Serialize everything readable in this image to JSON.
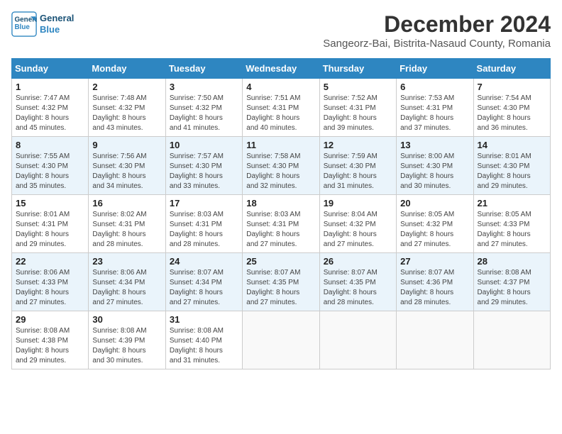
{
  "header": {
    "logo_line1": "General",
    "logo_line2": "Blue",
    "title": "December 2024",
    "subtitle": "Sangeorz-Bai, Bistrita-Nasaud County, Romania"
  },
  "weekdays": [
    "Sunday",
    "Monday",
    "Tuesday",
    "Wednesday",
    "Thursday",
    "Friday",
    "Saturday"
  ],
  "weeks": [
    [
      {
        "day": "1",
        "info": "Sunrise: 7:47 AM\nSunset: 4:32 PM\nDaylight: 8 hours\nand 45 minutes."
      },
      {
        "day": "2",
        "info": "Sunrise: 7:48 AM\nSunset: 4:32 PM\nDaylight: 8 hours\nand 43 minutes."
      },
      {
        "day": "3",
        "info": "Sunrise: 7:50 AM\nSunset: 4:32 PM\nDaylight: 8 hours\nand 41 minutes."
      },
      {
        "day": "4",
        "info": "Sunrise: 7:51 AM\nSunset: 4:31 PM\nDaylight: 8 hours\nand 40 minutes."
      },
      {
        "day": "5",
        "info": "Sunrise: 7:52 AM\nSunset: 4:31 PM\nDaylight: 8 hours\nand 39 minutes."
      },
      {
        "day": "6",
        "info": "Sunrise: 7:53 AM\nSunset: 4:31 PM\nDaylight: 8 hours\nand 37 minutes."
      },
      {
        "day": "7",
        "info": "Sunrise: 7:54 AM\nSunset: 4:30 PM\nDaylight: 8 hours\nand 36 minutes."
      }
    ],
    [
      {
        "day": "8",
        "info": "Sunrise: 7:55 AM\nSunset: 4:30 PM\nDaylight: 8 hours\nand 35 minutes."
      },
      {
        "day": "9",
        "info": "Sunrise: 7:56 AM\nSunset: 4:30 PM\nDaylight: 8 hours\nand 34 minutes."
      },
      {
        "day": "10",
        "info": "Sunrise: 7:57 AM\nSunset: 4:30 PM\nDaylight: 8 hours\nand 33 minutes."
      },
      {
        "day": "11",
        "info": "Sunrise: 7:58 AM\nSunset: 4:30 PM\nDaylight: 8 hours\nand 32 minutes."
      },
      {
        "day": "12",
        "info": "Sunrise: 7:59 AM\nSunset: 4:30 PM\nDaylight: 8 hours\nand 31 minutes."
      },
      {
        "day": "13",
        "info": "Sunrise: 8:00 AM\nSunset: 4:30 PM\nDaylight: 8 hours\nand 30 minutes."
      },
      {
        "day": "14",
        "info": "Sunrise: 8:01 AM\nSunset: 4:30 PM\nDaylight: 8 hours\nand 29 minutes."
      }
    ],
    [
      {
        "day": "15",
        "info": "Sunrise: 8:01 AM\nSunset: 4:31 PM\nDaylight: 8 hours\nand 29 minutes."
      },
      {
        "day": "16",
        "info": "Sunrise: 8:02 AM\nSunset: 4:31 PM\nDaylight: 8 hours\nand 28 minutes."
      },
      {
        "day": "17",
        "info": "Sunrise: 8:03 AM\nSunset: 4:31 PM\nDaylight: 8 hours\nand 28 minutes."
      },
      {
        "day": "18",
        "info": "Sunrise: 8:03 AM\nSunset: 4:31 PM\nDaylight: 8 hours\nand 27 minutes."
      },
      {
        "day": "19",
        "info": "Sunrise: 8:04 AM\nSunset: 4:32 PM\nDaylight: 8 hours\nand 27 minutes."
      },
      {
        "day": "20",
        "info": "Sunrise: 8:05 AM\nSunset: 4:32 PM\nDaylight: 8 hours\nand 27 minutes."
      },
      {
        "day": "21",
        "info": "Sunrise: 8:05 AM\nSunset: 4:33 PM\nDaylight: 8 hours\nand 27 minutes."
      }
    ],
    [
      {
        "day": "22",
        "info": "Sunrise: 8:06 AM\nSunset: 4:33 PM\nDaylight: 8 hours\nand 27 minutes."
      },
      {
        "day": "23",
        "info": "Sunrise: 8:06 AM\nSunset: 4:34 PM\nDaylight: 8 hours\nand 27 minutes."
      },
      {
        "day": "24",
        "info": "Sunrise: 8:07 AM\nSunset: 4:34 PM\nDaylight: 8 hours\nand 27 minutes."
      },
      {
        "day": "25",
        "info": "Sunrise: 8:07 AM\nSunset: 4:35 PM\nDaylight: 8 hours\nand 27 minutes."
      },
      {
        "day": "26",
        "info": "Sunrise: 8:07 AM\nSunset: 4:35 PM\nDaylight: 8 hours\nand 28 minutes."
      },
      {
        "day": "27",
        "info": "Sunrise: 8:07 AM\nSunset: 4:36 PM\nDaylight: 8 hours\nand 28 minutes."
      },
      {
        "day": "28",
        "info": "Sunrise: 8:08 AM\nSunset: 4:37 PM\nDaylight: 8 hours\nand 29 minutes."
      }
    ],
    [
      {
        "day": "29",
        "info": "Sunrise: 8:08 AM\nSunset: 4:38 PM\nDaylight: 8 hours\nand 29 minutes."
      },
      {
        "day": "30",
        "info": "Sunrise: 8:08 AM\nSunset: 4:39 PM\nDaylight: 8 hours\nand 30 minutes."
      },
      {
        "day": "31",
        "info": "Sunrise: 8:08 AM\nSunset: 4:40 PM\nDaylight: 8 hours\nand 31 minutes."
      },
      {
        "day": "",
        "info": ""
      },
      {
        "day": "",
        "info": ""
      },
      {
        "day": "",
        "info": ""
      },
      {
        "day": "",
        "info": ""
      }
    ]
  ]
}
